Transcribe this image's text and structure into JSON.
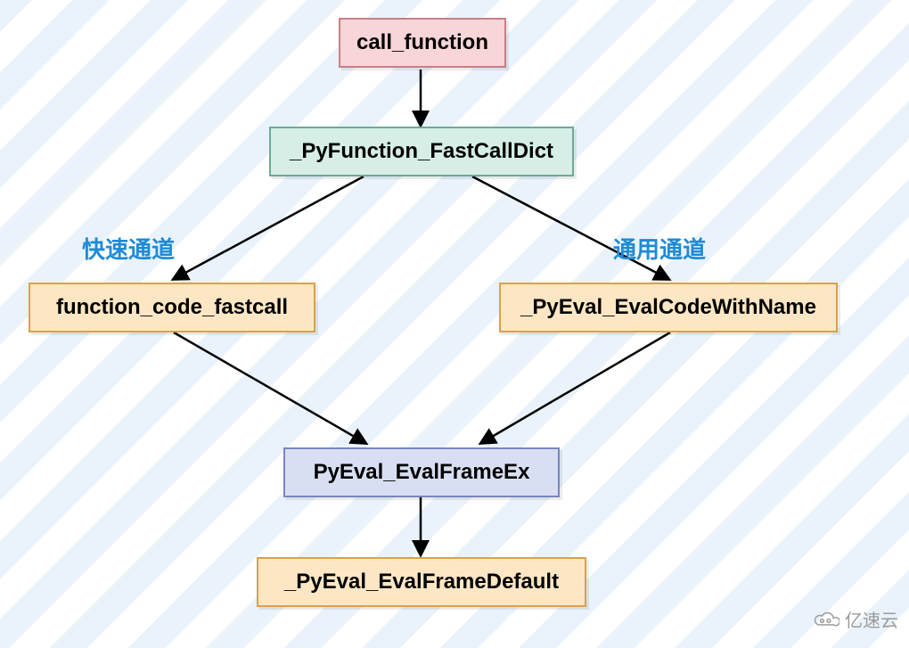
{
  "nodes": {
    "n1": {
      "label": "call_function"
    },
    "n2": {
      "label": "_PyFunction_FastCallDict"
    },
    "n3": {
      "label": "function_code_fastcall"
    },
    "n4": {
      "label": "_PyEval_EvalCodeWithName"
    },
    "n5": {
      "label": "PyEval_EvalFrameEx"
    },
    "n6": {
      "label": "_PyEval_EvalFrameDefault"
    }
  },
  "labels": {
    "left": "快速通道",
    "right": "通用通道"
  },
  "watermark": "亿速云",
  "chart_data": {
    "type": "flowchart",
    "title": "",
    "nodes": [
      {
        "id": "n1",
        "label": "call_function",
        "style": "pink"
      },
      {
        "id": "n2",
        "label": "_PyFunction_FastCallDict",
        "style": "green"
      },
      {
        "id": "n3",
        "label": "function_code_fastcall",
        "style": "orange"
      },
      {
        "id": "n4",
        "label": "_PyEval_EvalCodeWithName",
        "style": "orange"
      },
      {
        "id": "n5",
        "label": "PyEval_EvalFrameEx",
        "style": "blue"
      },
      {
        "id": "n6",
        "label": "_PyEval_EvalFrameDefault",
        "style": "orange"
      }
    ],
    "edges": [
      {
        "from": "n1",
        "to": "n2"
      },
      {
        "from": "n2",
        "to": "n3",
        "label": "快速通道"
      },
      {
        "from": "n2",
        "to": "n4",
        "label": "通用通道"
      },
      {
        "from": "n3",
        "to": "n5"
      },
      {
        "from": "n4",
        "to": "n5"
      },
      {
        "from": "n5",
        "to": "n6"
      }
    ]
  }
}
